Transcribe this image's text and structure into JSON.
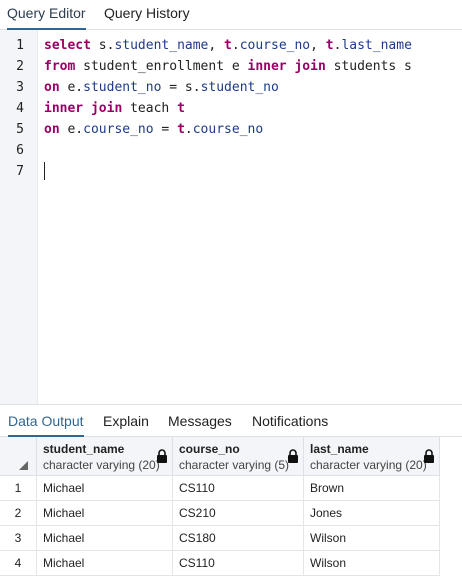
{
  "top_tabs": [
    {
      "label": "Query Editor",
      "active": true
    },
    {
      "label": "Query History",
      "active": false
    }
  ],
  "editor": {
    "line_numbers": [
      "1",
      "2",
      "3",
      "4",
      "5",
      "6",
      "7"
    ],
    "lines": [
      [
        {
          "t": "select",
          "c": "kw"
        },
        {
          "t": " s.",
          "c": "pl"
        },
        {
          "t": "student_name",
          "c": "id"
        },
        {
          "t": ", ",
          "c": "pl"
        },
        {
          "t": "t",
          "c": "kw"
        },
        {
          "t": ".",
          "c": "pl"
        },
        {
          "t": "course_no",
          "c": "id"
        },
        {
          "t": ", ",
          "c": "pl"
        },
        {
          "t": "t",
          "c": "kw"
        },
        {
          "t": ".",
          "c": "pl"
        },
        {
          "t": "last_name",
          "c": "id"
        }
      ],
      [
        {
          "t": "from",
          "c": "kw"
        },
        {
          "t": " student_enrollment e ",
          "c": "pl"
        },
        {
          "t": "inner join",
          "c": "kw"
        },
        {
          "t": " students s",
          "c": "pl"
        }
      ],
      [
        {
          "t": "on",
          "c": "kw"
        },
        {
          "t": " e.",
          "c": "pl"
        },
        {
          "t": "student_no",
          "c": "id"
        },
        {
          "t": " = s.",
          "c": "pl"
        },
        {
          "t": "student_no",
          "c": "id"
        }
      ],
      [
        {
          "t": "inner join",
          "c": "kw"
        },
        {
          "t": " teach ",
          "c": "pl"
        },
        {
          "t": "t",
          "c": "kw"
        }
      ],
      [
        {
          "t": "on",
          "c": "kw"
        },
        {
          "t": " e.",
          "c": "pl"
        },
        {
          "t": "course_no",
          "c": "id"
        },
        {
          "t": " = ",
          "c": "pl"
        },
        {
          "t": "t",
          "c": "kw"
        },
        {
          "t": ".",
          "c": "pl"
        },
        {
          "t": "course_no",
          "c": "id"
        }
      ],
      [],
      []
    ]
  },
  "bottom_tabs": [
    {
      "label": "Data Output",
      "active": true
    },
    {
      "label": "Explain",
      "active": false
    },
    {
      "label": "Messages",
      "active": false
    },
    {
      "label": "Notifications",
      "active": false
    }
  ],
  "grid": {
    "columns": [
      {
        "name": "student_name",
        "type": "character varying (20)"
      },
      {
        "name": "course_no",
        "type": "character varying (5)"
      },
      {
        "name": "last_name",
        "type": "character varying (20)"
      }
    ],
    "rows": [
      {
        "num": "1",
        "cells": [
          "Michael",
          "CS110",
          "Brown"
        ]
      },
      {
        "num": "2",
        "cells": [
          "Michael",
          "CS210",
          "Jones"
        ]
      },
      {
        "num": "3",
        "cells": [
          "Michael",
          "CS180",
          "Wilson"
        ]
      },
      {
        "num": "4",
        "cells": [
          "Michael",
          "CS110",
          "Wilson"
        ]
      }
    ]
  },
  "colors": {
    "keyword": "#990066",
    "identifier": "#1f3a8a",
    "accent": "#326690"
  }
}
